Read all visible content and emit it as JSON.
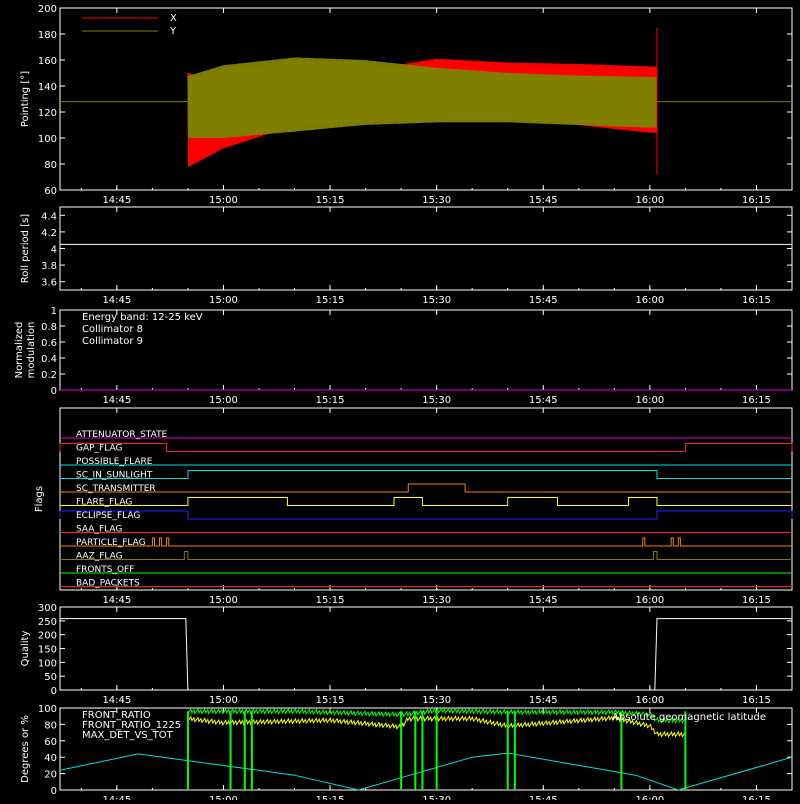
{
  "chart_data": [
    {
      "id": "pointing",
      "type": "line",
      "ylabel": "Pointing [°]",
      "ylim": [
        60,
        200
      ],
      "yticks": [
        60,
        80,
        100,
        120,
        140,
        160,
        180,
        200
      ],
      "legend": [
        {
          "name": "X",
          "color": "#ff0000"
        },
        {
          "name": "Y",
          "color": "#808000"
        }
      ],
      "baseline": 128,
      "data_start": "14:55",
      "data_end": "16:01",
      "series": [
        {
          "name": "X",
          "color": "#ff0000",
          "upper": [
            [
              14.92,
              150
            ],
            [
              15.0,
              140
            ],
            [
              15.17,
              146
            ],
            [
              15.33,
              152
            ],
            [
              15.5,
              161
            ],
            [
              15.67,
              158
            ],
            [
              15.83,
              157
            ],
            [
              16.0,
              155
            ]
          ],
          "lower": [
            [
              14.92,
              78
            ],
            [
              15.0,
              92
            ],
            [
              15.17,
              110
            ],
            [
              15.33,
              122
            ],
            [
              15.5,
              122
            ],
            [
              15.67,
              117
            ],
            [
              15.83,
              110
            ],
            [
              16.0,
              104
            ]
          ]
        },
        {
          "name": "Y",
          "color": "#808000",
          "upper": [
            [
              14.92,
              148
            ],
            [
              15.0,
              156
            ],
            [
              15.17,
              162
            ],
            [
              15.33,
              160
            ],
            [
              15.5,
              154
            ],
            [
              15.67,
              150
            ],
            [
              15.83,
              148
            ],
            [
              16.0,
              147
            ]
          ],
          "lower": [
            [
              14.92,
              100
            ],
            [
              15.0,
              100
            ],
            [
              15.17,
              105
            ],
            [
              15.33,
              110
            ],
            [
              15.5,
              112
            ],
            [
              15.67,
              112
            ],
            [
              15.83,
              110
            ],
            [
              16.0,
              108
            ]
          ]
        }
      ]
    },
    {
      "id": "roll",
      "type": "line",
      "ylabel": "Roll period [s]",
      "ylim": [
        3.5,
        4.5
      ],
      "yticks": [
        3.6,
        3.8,
        4.0,
        4.2,
        4.4
      ],
      "value": 4.05
    },
    {
      "id": "modulation",
      "type": "line",
      "ylabel": "Normalized modulation",
      "ylim": [
        0.0,
        1.0
      ],
      "yticks": [
        0.0,
        0.2,
        0.4,
        0.6,
        0.8,
        1.0
      ],
      "annotations": [
        {
          "text": "Energy band: 12-25 keV",
          "color": "#ffffff"
        },
        {
          "text": "Collimator 8",
          "color": "#00e0e0"
        },
        {
          "text": "Collimator 9",
          "color": "#e000e0"
        }
      ],
      "value": 0.0
    },
    {
      "id": "flags",
      "type": "line",
      "ylabel": "Flags",
      "flags": [
        {
          "name": "ATTENUATOR_STATE",
          "color": "#e000e0",
          "on": []
        },
        {
          "name": "GAP_FLAG",
          "color": "#ff2020",
          "on": [
            [
              "14:37",
              "14:52"
            ],
            [
              "16:05",
              "16:20"
            ]
          ]
        },
        {
          "name": "POSSIBLE_FLARE",
          "color": "#00e0e0",
          "on": []
        },
        {
          "name": "SC_IN_SUNLIGHT",
          "color": "#00e0e0",
          "on": [
            [
              "14:55",
              "16:01"
            ]
          ]
        },
        {
          "name": "SC_TRANSMITTER",
          "color": "#ff8000",
          "on": [
            [
              "15:26",
              "15:34"
            ]
          ]
        },
        {
          "name": "FLARE_FLAG",
          "color": "#ffff00",
          "on": [
            [
              "14:55",
              "15:09"
            ],
            [
              "15:24",
              "15:28"
            ],
            [
              "15:40",
              "15:47"
            ],
            [
              "15:57",
              "16:01"
            ]
          ]
        },
        {
          "name": "ECLIPSE_FLAG",
          "color": "#2020ff",
          "on": [
            [
              "14:37",
              "14:55"
            ],
            [
              "16:01",
              "16:20"
            ]
          ]
        },
        {
          "name": "SAA_FLAG",
          "color": "#ff2020",
          "on": []
        },
        {
          "name": "PARTICLE_FLAG",
          "color": "#ff8000",
          "on": [
            [
              "14:50",
              "14:50.3"
            ],
            [
              "14:51",
              "14:51.3"
            ],
            [
              "14:52",
              "14:52.3"
            ],
            [
              "15:59",
              "15:59.3"
            ],
            [
              "16:03",
              "16:03.3"
            ],
            [
              "16:04",
              "16:04.3"
            ]
          ]
        },
        {
          "name": "AAZ_FLAG",
          "color": "#808000",
          "on": [
            [
              "14:54.5",
              "14:55"
            ],
            [
              "16:00.5",
              "16:01"
            ]
          ]
        },
        {
          "name": "FRONTS_OFF",
          "color": "#00ff00",
          "on": []
        },
        {
          "name": "BAD_PACKETS",
          "color": "#ff2020",
          "on": []
        }
      ]
    },
    {
      "id": "quality",
      "type": "line",
      "ylabel": "Quality",
      "ylim": [
        0,
        300
      ],
      "yticks": [
        0,
        50,
        100,
        150,
        200,
        250,
        300
      ],
      "series": [
        {
          "name": "Quality",
          "color": "#ffffff",
          "points": [
            [
              "14:37",
              258
            ],
            [
              "14:54.7",
              258
            ],
            [
              "14:55",
              0
            ],
            [
              "16:00.7",
              0
            ],
            [
              "16:01",
              258
            ],
            [
              "16:20",
              258
            ]
          ]
        }
      ]
    },
    {
      "id": "degrees",
      "type": "line",
      "ylabel": "Degrees or %",
      "ylim": [
        0,
        100
      ],
      "yticks": [
        0,
        20,
        40,
        60,
        80,
        100
      ],
      "legend": [
        {
          "name": "FRONT_RATIO",
          "color": "#00ff00"
        },
        {
          "name": "FRONT_RATIO_1225",
          "color": "#ffff00"
        },
        {
          "name": "MAX_DET_VS_TOT",
          "color": "#ff8000"
        },
        {
          "name": "Absolute geomagnetic latitude",
          "color": "#00e0e0"
        }
      ],
      "series": [
        {
          "name": "Absolute geomagnetic latitude",
          "color": "#00e0e0",
          "points": [
            [
              "14:37",
              24
            ],
            [
              "14:48",
              44
            ],
            [
              "15:10",
              18
            ],
            [
              "15:19",
              0
            ],
            [
              "15:35",
              40
            ],
            [
              "15:40",
              45
            ],
            [
              "15:58",
              18
            ],
            [
              "16:04",
              0
            ],
            [
              "16:20",
              40
            ]
          ]
        },
        {
          "name": "FRONT_RATIO_1225",
          "color": "#ffff00",
          "points": [
            [
              "14:55",
              87
            ],
            [
              "15:00",
              82
            ],
            [
              "15:15",
              85
            ],
            [
              "15:25",
              77
            ],
            [
              "15:26",
              87
            ],
            [
              "15:35",
              87
            ],
            [
              "15:40",
              78
            ],
            [
              "15:55",
              88
            ],
            [
              "16:00",
              78
            ],
            [
              "16:01",
              68
            ],
            [
              "16:05",
              68
            ]
          ]
        },
        {
          "name": "FRONT_RATIO",
          "color": "#00ff00",
          "points": [
            [
              "14:55",
              96
            ],
            [
              "15:10",
              96
            ],
            [
              "15:25",
              92
            ],
            [
              "15:30",
              97
            ],
            [
              "15:40",
              95
            ],
            [
              "15:55",
              95
            ],
            [
              "16:00",
              92
            ],
            [
              "16:01",
              85
            ],
            [
              "16:05",
              85
            ]
          ]
        }
      ]
    }
  ],
  "x_axis": {
    "range": [
      "14:37",
      "16:20"
    ],
    "ticks": [
      "14:45",
      "15:00",
      "15:15",
      "15:30",
      "15:45",
      "16:00",
      "16:15"
    ]
  }
}
